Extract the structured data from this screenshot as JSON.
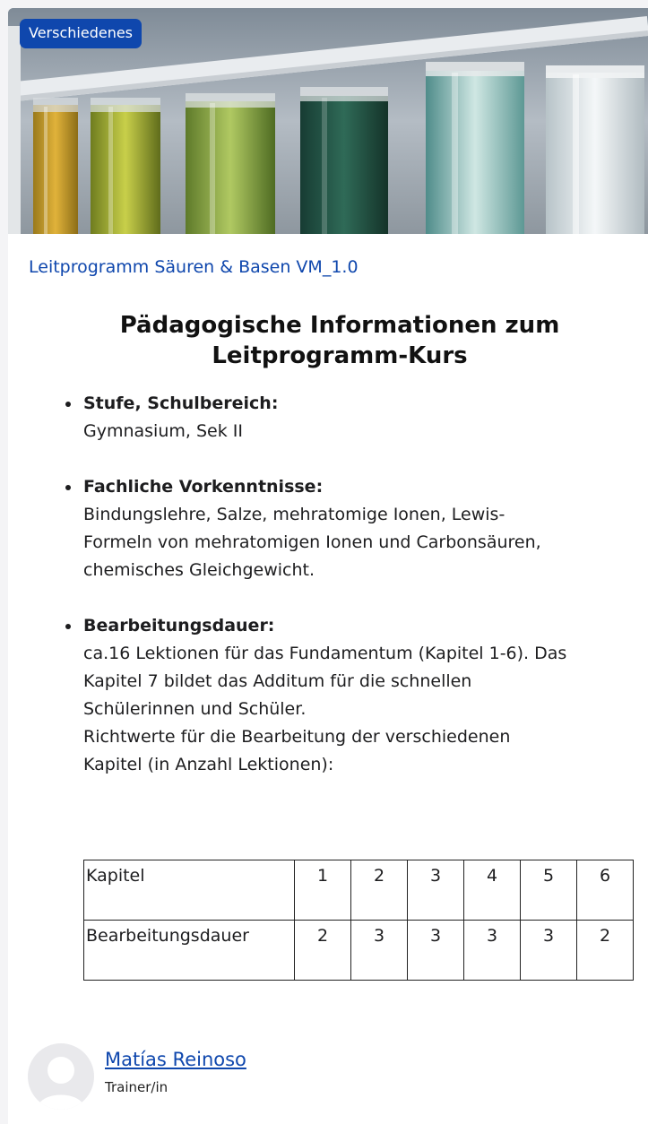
{
  "badge": {
    "label": "Verschiedenes"
  },
  "course": {
    "title": "Leitprogramm Säuren & Basen VM_1.0"
  },
  "content": {
    "heading": "Pädagogische Informationen zum Leitprogramm-Kurs",
    "items": [
      {
        "label": "Stufe, Schulbereich:",
        "text": "Gymnasium, Sek II"
      },
      {
        "label": "Fachliche Vorkenntnisse:",
        "text": "Bindungslehre, Salze, mehratomige Ionen, Lewis-\nFormeln von mehratomigen Ionen und Carbonsäuren,\nchemisches Gleichgewicht."
      },
      {
        "label": "Bearbeitungsdauer:",
        "text": "ca.16 Lektionen für das Fundamentum (Kapitel 1-6). Das\nKapitel 7 bildet das Additum für die schnellen\nSchülerinnen und Schüler.\nRichtwerte für die Bearbeitung der verschiedenen\nKapitel (in Anzahl Lektionen):"
      }
    ],
    "table": {
      "header_label": "Kapitel",
      "chapters": [
        "1",
        "2",
        "3",
        "4",
        "5",
        "6"
      ],
      "row_label": "Bearbeitungsdauer",
      "durations": [
        "2",
        "3",
        "3",
        "3",
        "3",
        "2"
      ]
    }
  },
  "trainer": {
    "name": "Matías Reinoso",
    "role": "Trainer/in"
  },
  "colors": {
    "accent": "#0f47ad",
    "text": "#1d1d1f"
  },
  "icons": {
    "avatar": "default-user-avatar-icon",
    "bullet": "bullet-icon"
  }
}
